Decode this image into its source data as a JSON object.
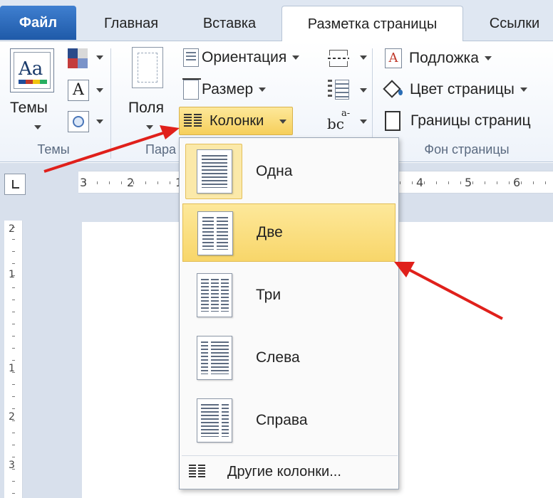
{
  "tabs": {
    "file": "Файл",
    "home": "Главная",
    "insert": "Вставка",
    "layout": "Разметка страницы",
    "links": "Ссылки"
  },
  "ribbon": {
    "themes_label": "Темы",
    "themes_group": "Темы",
    "margins_label": "Поля",
    "page_setup_group_partial": "Пара",
    "orientation": "Ориентация",
    "size": "Размер",
    "columns": "Колонки",
    "watermark": "Подложка",
    "page_color": "Цвет страницы",
    "page_borders": "Границы страниц",
    "page_background_group": "Фон страницы",
    "hyphen_icon_text": "bc",
    "hyphen_super": "a-"
  },
  "ruler": {
    "h_ticks": [
      "3",
      "2",
      "1",
      "4",
      "5",
      "6"
    ],
    "v_ticks": [
      "2",
      "1",
      "1",
      "2",
      "3"
    ]
  },
  "columns_menu": {
    "items": [
      "Одна",
      "Две",
      "Три",
      "Слева",
      "Справа"
    ],
    "more": "Другие колонки..."
  },
  "colors": {
    "accent_blue": "#1f5aa8",
    "highlight": "#f8d66a",
    "arrow_red": "#e0201b"
  }
}
